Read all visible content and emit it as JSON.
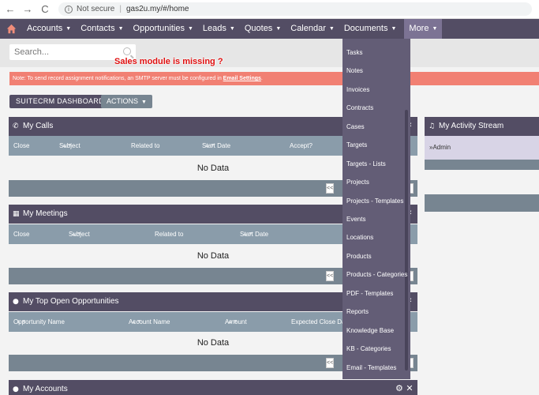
{
  "browser": {
    "back_glyph": "←",
    "forward_glyph": "→",
    "reload_glyph": "C",
    "info_glyph": "i",
    "security": "Not secure",
    "separator": "|",
    "url": "gas2u.my/#/home"
  },
  "nav": {
    "caret": "▼",
    "items": [
      "Accounts",
      "Contacts",
      "Opportunities",
      "Leads",
      "Quotes",
      "Calendar",
      "Documents",
      "More"
    ]
  },
  "search": {
    "placeholder": "Search..."
  },
  "annotation": "Sales module is missing ?",
  "notice": {
    "text": "Note: To send record assignment notifications, an SMTP server must be configured in ",
    "link": "Email Settings",
    "end": "."
  },
  "buttons": {
    "dashboard": "SUITECRM DASHBOARD",
    "actions": "ACTIONS"
  },
  "icons": {
    "sort_glyph": "▲▼",
    "pager_glyph": "<<",
    "chevron_glyph": "‹",
    "gear_glyph": "⚙",
    "close_glyph": "✕"
  },
  "dashlets": {
    "calls": {
      "icon": "✆",
      "title": "My Calls",
      "columns": [
        "Close",
        "Subject",
        "Related to",
        "Start Date",
        "Accept?"
      ],
      "empty": "No Data"
    },
    "meetings": {
      "icon": "▦",
      "title": "My Meetings",
      "columns": [
        "Close",
        "Subject",
        "Related to",
        "Start Date"
      ],
      "empty": "No Data"
    },
    "opportunities": {
      "icon": "●",
      "title": "My Top Open Opportunities",
      "columns": [
        "Opportunity Name",
        "Account Name",
        "Amount",
        "Expected Close Date"
      ],
      "empty": "No Data"
    },
    "accounts": {
      "icon": "●",
      "title": "My Accounts"
    }
  },
  "activity": {
    "icon": "♫",
    "title": "My Activity Stream",
    "user": "»Admin"
  },
  "more_menu": [
    "Tasks",
    "Notes",
    "Invoices",
    "Contracts",
    "Cases",
    "Targets",
    "Targets - Lists",
    "Projects",
    "Projects - Templates",
    "Events",
    "Locations",
    "Products",
    "Products - Categories",
    "PDF - Templates",
    "Reports",
    "Knowledge Base",
    "KB - Categories",
    "Email - Templates"
  ],
  "colors": {
    "nav": "#534d64",
    "header_row": "#8a9caa",
    "footer": "#778591",
    "notice": "#f18073",
    "dropdown": "#635d76"
  }
}
